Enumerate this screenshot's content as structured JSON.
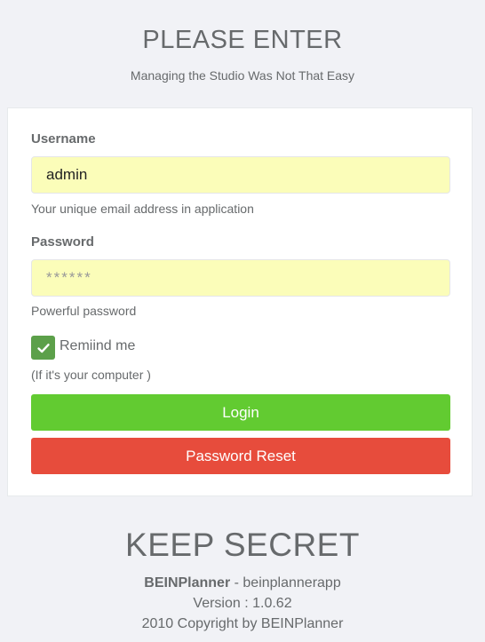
{
  "header": {
    "title": "PLEASE ENTER",
    "subtitle": "Managing the Studio Was Not That Easy"
  },
  "form": {
    "username": {
      "label": "Username",
      "value": "admin",
      "help": "Your unique email address in application"
    },
    "password": {
      "label": "Password",
      "placeholder": "******",
      "help": "Powerful password"
    },
    "remember": {
      "label": "Remiind me",
      "checked": true,
      "help": "(If it's your computer )"
    },
    "login_button": "Login",
    "reset_button": "Password Reset"
  },
  "footer": {
    "title": "KEEP SECRET",
    "brand": "BEINPlanner",
    "app_suffix": " - beinplannerapp",
    "version": "Version : 1.0.62",
    "copyright": "2010 Copyright by BEINPlanner"
  },
  "colors": {
    "background": "#f1f2f6",
    "input_fill": "#fbfdb9",
    "checkbox": "#5ca04a",
    "login": "#62cb31",
    "reset": "#e74c3c"
  },
  "icons": [
    "check-icon"
  ]
}
